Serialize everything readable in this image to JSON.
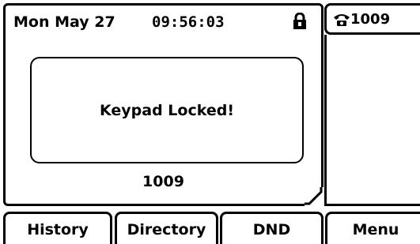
{
  "status_bar": {
    "date": "Mon May 27",
    "time": "09:56:03",
    "lock_icon": "padlock-icon"
  },
  "message": {
    "text": "Keypad Locked!"
  },
  "account": {
    "number": "1009"
  },
  "line_keys": [
    {
      "icon": "phone-icon",
      "label": "1009"
    }
  ],
  "softkeys": [
    {
      "label": "History"
    },
    {
      "label": "Directory"
    },
    {
      "label": "DND"
    },
    {
      "label": "Menu"
    }
  ]
}
